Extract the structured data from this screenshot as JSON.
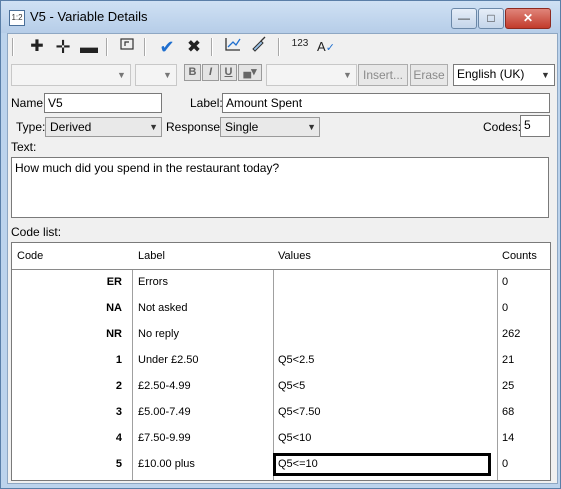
{
  "window": {
    "title": "V5 - Variable Details",
    "app_icon_text": "1:2"
  },
  "toolbar": {
    "icons": [
      "plus-icon",
      "plus-bold-icon",
      "minus-icon",
      "nested-icon",
      "check-icon",
      "cross-icon",
      "chart-icon",
      "paint-icon",
      "numbers-icon",
      "spellcheck-icon"
    ],
    "numbers_icon_text": "123",
    "spell_icon_text": "A"
  },
  "format_bar": {
    "bold": "B",
    "italic": "I",
    "underline": "U",
    "insert_label": "Insert...",
    "erase_label": "Erase",
    "language": "English (UK)"
  },
  "form": {
    "name_label": "Name:",
    "name_value": "V5",
    "label_label": "Label:",
    "label_value": "Amount Spent",
    "type_label": "Type:",
    "type_value": "Derived",
    "response_label": "Response:",
    "response_value": "Single",
    "codes_label": "Codes:",
    "codes_value": "5",
    "text_label": "Text:",
    "text_value": "How much did you spend in the restaurant today?",
    "code_list_label": "Code list:"
  },
  "code_list": {
    "headers": [
      "Code",
      "Label",
      "Values",
      "Counts"
    ],
    "rows": [
      {
        "code": "ER",
        "label": "Errors",
        "values": "",
        "counts": "0"
      },
      {
        "code": "NA",
        "label": "Not asked",
        "values": "",
        "counts": "0"
      },
      {
        "code": "NR",
        "label": "No reply",
        "values": "",
        "counts": "262"
      },
      {
        "code": "1",
        "label": "Under £2.50",
        "values": "Q5<2.5",
        "counts": "21"
      },
      {
        "code": "2",
        "label": "£2.50-4.99",
        "values": "Q5<5",
        "counts": "25"
      },
      {
        "code": "3",
        "label": "£5.00-7.49",
        "values": "Q5<7.50",
        "counts": "68"
      },
      {
        "code": "4",
        "label": "£7.50-9.99",
        "values": "Q5<10",
        "counts": "14"
      },
      {
        "code": "5",
        "label": "£10.00 plus",
        "values": "Q5<=10",
        "counts": "0"
      }
    ]
  }
}
